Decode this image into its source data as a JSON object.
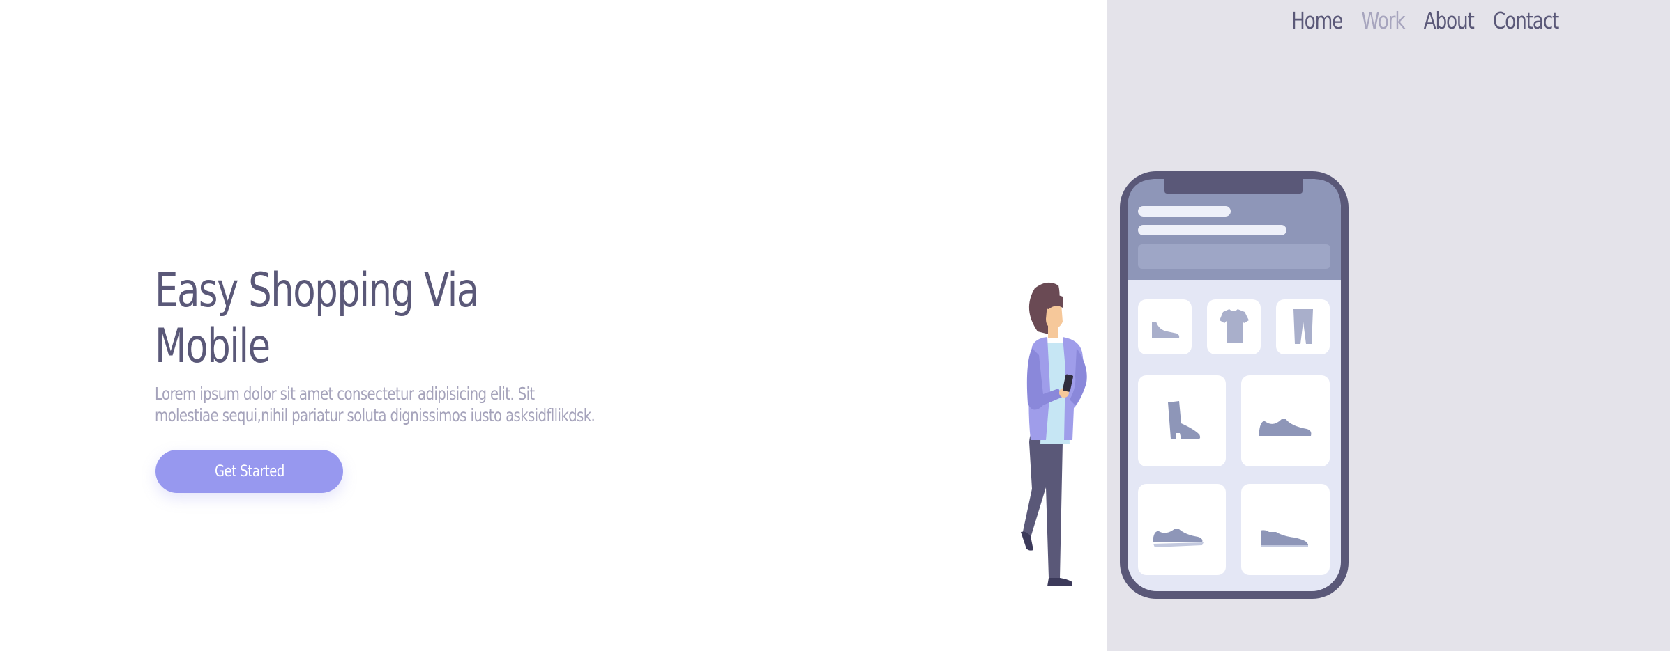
{
  "nav": {
    "items": [
      {
        "label": "Home",
        "active": false
      },
      {
        "label": "Work",
        "active": true
      },
      {
        "label": "About",
        "active": false
      },
      {
        "label": "Contact",
        "active": false
      }
    ]
  },
  "hero": {
    "title_line1": "Easy Shopping Via",
    "title_line2": "Mobile",
    "subtitle_line1": "Lorem ipsum dolor sit amet consectetur adipisicing elit. Sit",
    "subtitle_line2": "molestiae sequi,nihil pariatur soluta dignissimos iusto asksidfllikdsk.",
    "cta_label": "Get Started"
  },
  "colors": {
    "accent": "#9798ef",
    "text_dark": "#5a5878",
    "text_muted": "#a5a3bb",
    "panel_bg": "#e4e3ea",
    "phone_frame": "#5a5878",
    "phone_header": "#8e96b8"
  },
  "illustration": {
    "icons": [
      "shoe-icon",
      "tshirt-icon",
      "pants-icon",
      "boot-icon",
      "sneaker-icon",
      "sneaker-icon",
      "sneaker-icon"
    ]
  }
}
